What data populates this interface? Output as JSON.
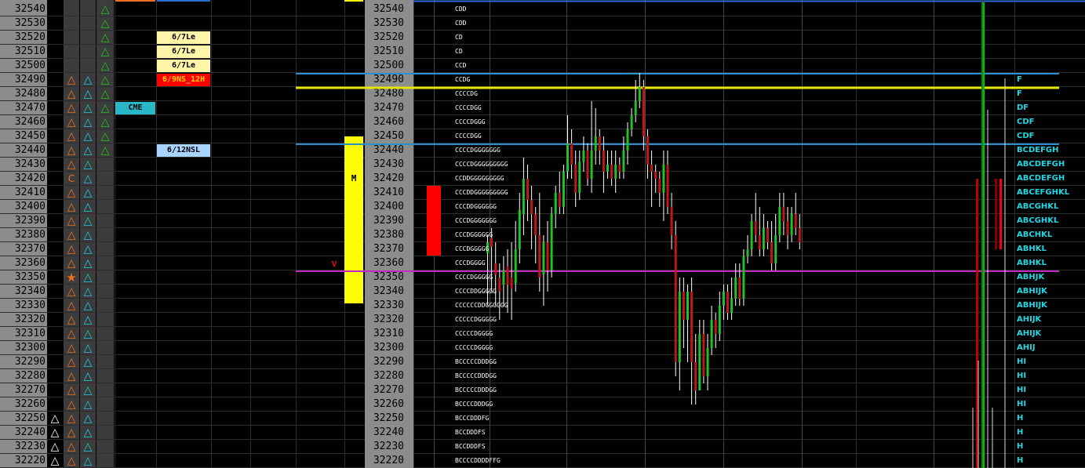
{
  "prices": [
    32540,
    32530,
    32520,
    32510,
    32500,
    32490,
    32480,
    32470,
    32460,
    32450,
    32440,
    32430,
    32420,
    32410,
    32400,
    32390,
    32380,
    32370,
    32360,
    32350,
    32340,
    32330,
    32320,
    32310,
    32300,
    32290,
    32280,
    32270,
    32260,
    32250,
    32240,
    32230,
    32220
  ],
  "markers": {
    "white_triangles": [
      32250,
      32240,
      32230,
      32220
    ],
    "orange_triangles": [
      32490,
      32480,
      32470,
      32460,
      32450,
      32440,
      32430,
      32410,
      32400,
      32390,
      32380,
      32370,
      32360,
      32340,
      32330,
      32320,
      32310,
      32300,
      32290,
      32280,
      32270,
      32260,
      32250,
      32240,
      32230,
      32220
    ],
    "orange_letter": {
      "price": 32420,
      "glyph": "C"
    },
    "orange_star": {
      "price": 32350,
      "glyph": "★"
    },
    "cyan_triangles": [
      32490,
      32480,
      32470,
      32460,
      32450,
      32440,
      32430,
      32420,
      32410,
      32400,
      32390,
      32380,
      32370,
      32360,
      32350,
      32340,
      32330,
      32320,
      32310,
      32300,
      32290,
      32280,
      32270,
      32260,
      32250,
      32240,
      32230,
      32220
    ],
    "green_triangles": [
      32540,
      32530,
      32520,
      32510,
      32500,
      32490,
      32480,
      32470,
      32460,
      32450,
      32440
    ],
    "triangle_glyph": "△"
  },
  "labels": {
    "cme": {
      "text": "CME",
      "price": 32470
    },
    "tags": [
      {
        "text": "6/7Le",
        "price": 32520,
        "style": "yellow"
      },
      {
        "text": "6/7Le",
        "price": 32510,
        "style": "yellow"
      },
      {
        "text": "6/7Le",
        "price": 32500,
        "style": "yellow"
      },
      {
        "text": "6/9NS_12H",
        "price": 32490,
        "style": "red"
      },
      {
        "text": "6/12NSL",
        "price": 32440,
        "style": "blue"
      }
    ],
    "v_marker": {
      "text": "v",
      "price": 32360
    },
    "m_marker": {
      "text": "M",
      "price": 32420
    }
  },
  "tpo_profile": [
    {
      "price": 32540,
      "text": "CDD"
    },
    {
      "price": 32530,
      "text": "CDD"
    },
    {
      "price": 32520,
      "text": "CD"
    },
    {
      "price": 32510,
      "text": "CD"
    },
    {
      "price": 32500,
      "text": "CCD"
    },
    {
      "price": 32490,
      "text": "CCDG"
    },
    {
      "price": 32480,
      "text": "CCCCDG"
    },
    {
      "price": 32470,
      "text": "CCCCDGG"
    },
    {
      "price": 32460,
      "text": "CCCCDGGG"
    },
    {
      "price": 32450,
      "text": "CCCCDGG"
    },
    {
      "price": 32440,
      "text": "CCCCDGGGGGGG"
    },
    {
      "price": 32430,
      "text": "CCCCDGGGGGGGGG"
    },
    {
      "price": 32420,
      "text": "CCDDGGGGGGGGG"
    },
    {
      "price": 32410,
      "text": "CCCDDGGGGGGGGG"
    },
    {
      "price": 32400,
      "text": "CCCDDGGGGGG"
    },
    {
      "price": 32390,
      "text": "CCCDGGGGGGG"
    },
    {
      "price": 32380,
      "text": "CCCDGGGGGG"
    },
    {
      "price": 32370,
      "text": "CCCDGGGGG"
    },
    {
      "price": 32360,
      "text": "CCCDGGGG"
    },
    {
      "price": 32350,
      "text": "CCCCDGGGGG"
    },
    {
      "price": 32340,
      "text": "CCCCDDGGGGG"
    },
    {
      "price": 32330,
      "text": "CCCCCCDDGGGGGG"
    },
    {
      "price": 32320,
      "text": "CCCCCDGGGGG"
    },
    {
      "price": 32310,
      "text": "CCCCCDGGGG"
    },
    {
      "price": 32300,
      "text": "CCCCCDGGGG"
    },
    {
      "price": 32290,
      "text": "BCCCCCDDDGG"
    },
    {
      "price": 32280,
      "text": "BCCCCCDDDGG"
    },
    {
      "price": 32270,
      "text": "BCCCCCDDDGG"
    },
    {
      "price": 32260,
      "text": "BCCCCDDDGG"
    },
    {
      "price": 32250,
      "text": "BCCCDDDFG"
    },
    {
      "price": 32240,
      "text": "BCCDDDFS"
    },
    {
      "price": 32230,
      "text": "BCCDDDFS"
    },
    {
      "price": 32220,
      "text": "BCCCCDDDDFFG"
    }
  ],
  "period_profile": [
    {
      "price": 32490,
      "text": "F"
    },
    {
      "price": 32480,
      "text": "F"
    },
    {
      "price": 32470,
      "text": "DF"
    },
    {
      "price": 32460,
      "text": "CDF"
    },
    {
      "price": 32450,
      "text": "CDF"
    },
    {
      "price": 32440,
      "text": "BCDEFGH"
    },
    {
      "price": 32430,
      "text": "ABCDEFGH"
    },
    {
      "price": 32420,
      "text": "ABCDEFGH"
    },
    {
      "price": 32410,
      "text": "ABCEFGHKL"
    },
    {
      "price": 32400,
      "text": "ABCGHKL"
    },
    {
      "price": 32390,
      "text": "ABCGHKL"
    },
    {
      "price": 32380,
      "text": "ABCHKL"
    },
    {
      "price": 32370,
      "text": "ABHKL"
    },
    {
      "price": 32360,
      "text": "ABHKL"
    },
    {
      "price": 32350,
      "text": "ABHJK"
    },
    {
      "price": 32340,
      "text": "ABHIJK"
    },
    {
      "price": 32330,
      "text": "ABHIJK"
    },
    {
      "price": 32320,
      "text": "AHIJK"
    },
    {
      "price": 32310,
      "text": "AHIJK"
    },
    {
      "price": 32300,
      "text": "AHIJ"
    },
    {
      "price": 32290,
      "text": "HI"
    },
    {
      "price": 32280,
      "text": "HI"
    },
    {
      "price": 32270,
      "text": "HI"
    },
    {
      "price": 32260,
      "text": "HI"
    },
    {
      "price": 32250,
      "text": "H"
    },
    {
      "price": 32240,
      "text": "H"
    },
    {
      "price": 32230,
      "text": "H"
    },
    {
      "price": 32220,
      "text": "H"
    }
  ],
  "level_lines": [
    {
      "price": 32490,
      "color": "#2a8fd0"
    },
    {
      "price": 32480,
      "color": "#e6e600"
    },
    {
      "price": 32440,
      "color": "#2a8fd0"
    },
    {
      "price": 32350,
      "color": "#c02ac0"
    }
  ],
  "candles": [
    {
      "o": 32367,
      "c": 32375,
      "h": 32380,
      "l": 32330
    },
    {
      "o": 32378,
      "c": 32372,
      "h": 32385,
      "l": 32340
    },
    {
      "o": 32360,
      "c": 32352,
      "h": 32375,
      "l": 32330
    },
    {
      "o": 32350,
      "c": 32340,
      "h": 32360,
      "l": 32320
    },
    {
      "o": 32345,
      "c": 32355,
      "h": 32365,
      "l": 32330
    },
    {
      "o": 32358,
      "c": 32345,
      "h": 32370,
      "l": 32325
    },
    {
      "o": 32350,
      "c": 32342,
      "h": 32375,
      "l": 32320
    },
    {
      "o": 32346,
      "c": 32370,
      "h": 32390,
      "l": 32340
    },
    {
      "o": 32370,
      "c": 32398,
      "h": 32410,
      "l": 32360
    },
    {
      "o": 32395,
      "c": 32420,
      "h": 32435,
      "l": 32380
    },
    {
      "o": 32420,
      "c": 32405,
      "h": 32430,
      "l": 32390
    },
    {
      "o": 32405,
      "c": 32395,
      "h": 32415,
      "l": 32370
    },
    {
      "o": 32395,
      "c": 32380,
      "h": 32400,
      "l": 32360
    },
    {
      "o": 32380,
      "c": 32350,
      "h": 32410,
      "l": 32340
    },
    {
      "o": 32352,
      "c": 32375,
      "h": 32380,
      "l": 32330
    },
    {
      "o": 32375,
      "c": 32355,
      "h": 32390,
      "l": 32340
    },
    {
      "o": 32355,
      "c": 32395,
      "h": 32400,
      "l": 32350
    },
    {
      "o": 32395,
      "c": 32410,
      "h": 32415,
      "l": 32385
    },
    {
      "o": 32410,
      "c": 32400,
      "h": 32425,
      "l": 32395
    },
    {
      "o": 32400,
      "c": 32425,
      "h": 32430,
      "l": 32395
    },
    {
      "o": 32425,
      "c": 32445,
      "h": 32465,
      "l": 32420
    },
    {
      "o": 32445,
      "c": 32430,
      "h": 32455,
      "l": 32420
    },
    {
      "o": 32430,
      "c": 32410,
      "h": 32440,
      "l": 32400
    },
    {
      "o": 32410,
      "c": 32432,
      "h": 32440,
      "l": 32405
    },
    {
      "o": 32432,
      "c": 32440,
      "h": 32450,
      "l": 32425
    },
    {
      "o": 32440,
      "c": 32420,
      "h": 32445,
      "l": 32415
    },
    {
      "o": 32420,
      "c": 32440,
      "h": 32475,
      "l": 32410
    },
    {
      "o": 32440,
      "c": 32450,
      "h": 32470,
      "l": 32430
    },
    {
      "o": 32450,
      "c": 32440,
      "h": 32455,
      "l": 32430
    },
    {
      "o": 32440,
      "c": 32425,
      "h": 32450,
      "l": 32410
    },
    {
      "o": 32425,
      "c": 32430,
      "h": 32440,
      "l": 32420
    },
    {
      "o": 32430,
      "c": 32420,
      "h": 32440,
      "l": 32415
    },
    {
      "o": 32420,
      "c": 32430,
      "h": 32440,
      "l": 32410
    },
    {
      "o": 32430,
      "c": 32425,
      "h": 32435,
      "l": 32420
    },
    {
      "o": 32425,
      "c": 32440,
      "h": 32450,
      "l": 32420
    },
    {
      "o": 32440,
      "c": 32455,
      "h": 32460,
      "l": 32430
    },
    {
      "o": 32455,
      "c": 32465,
      "h": 32470,
      "l": 32450
    },
    {
      "o": 32465,
      "c": 32475,
      "h": 32490,
      "l": 32460
    },
    {
      "o": 32475,
      "c": 32485,
      "h": 32495,
      "l": 32470
    },
    {
      "o": 32485,
      "c": 32450,
      "h": 32490,
      "l": 32440
    },
    {
      "o": 32450,
      "c": 32430,
      "h": 32455,
      "l": 32420
    },
    {
      "o": 32430,
      "c": 32425,
      "h": 32440,
      "l": 32400
    },
    {
      "o": 32425,
      "c": 32420,
      "h": 32430,
      "l": 32410
    },
    {
      "o": 32420,
      "c": 32410,
      "h": 32425,
      "l": 32400
    },
    {
      "o": 32410,
      "c": 32430,
      "h": 32440,
      "l": 32390
    },
    {
      "o": 32430,
      "c": 32400,
      "h": 32440,
      "l": 32395
    },
    {
      "o": 32400,
      "c": 32380,
      "h": 32410,
      "l": 32370
    },
    {
      "o": 32380,
      "c": 32290,
      "h": 32390,
      "l": 32280
    },
    {
      "o": 32290,
      "c": 32340,
      "h": 32350,
      "l": 32270
    },
    {
      "o": 32340,
      "c": 32320,
      "h": 32350,
      "l": 32300
    },
    {
      "o": 32320,
      "c": 32340,
      "h": 32345,
      "l": 32290
    },
    {
      "o": 32340,
      "c": 32290,
      "h": 32350,
      "l": 32260
    },
    {
      "o": 32290,
      "c": 32270,
      "h": 32310,
      "l": 32260
    },
    {
      "o": 32270,
      "c": 32310,
      "h": 32320,
      "l": 32270
    },
    {
      "o": 32310,
      "c": 32280,
      "h": 32320,
      "l": 32275
    },
    {
      "o": 32280,
      "c": 32300,
      "h": 32310,
      "l": 32270
    },
    {
      "o": 32300,
      "c": 32320,
      "h": 32330,
      "l": 32295
    },
    {
      "o": 32320,
      "c": 32310,
      "h": 32325,
      "l": 32300
    },
    {
      "o": 32310,
      "c": 32330,
      "h": 32340,
      "l": 32305
    },
    {
      "o": 32330,
      "c": 32340,
      "h": 32345,
      "l": 32320
    },
    {
      "o": 32340,
      "c": 32325,
      "h": 32345,
      "l": 32320
    },
    {
      "o": 32325,
      "c": 32335,
      "h": 32350,
      "l": 32320
    },
    {
      "o": 32335,
      "c": 32350,
      "h": 32360,
      "l": 32330
    },
    {
      "o": 32350,
      "c": 32335,
      "h": 32360,
      "l": 32330
    },
    {
      "o": 32335,
      "c": 32365,
      "h": 32370,
      "l": 32330
    },
    {
      "o": 32365,
      "c": 32370,
      "h": 32380,
      "l": 32360
    },
    {
      "o": 32370,
      "c": 32390,
      "h": 32395,
      "l": 32365
    },
    {
      "o": 32390,
      "c": 32380,
      "h": 32410,
      "l": 32375
    },
    {
      "o": 32380,
      "c": 32370,
      "h": 32400,
      "l": 32365
    },
    {
      "o": 32370,
      "c": 32385,
      "h": 32395,
      "l": 32365
    },
    {
      "o": 32385,
      "c": 32375,
      "h": 32390,
      "l": 32370
    },
    {
      "o": 32375,
      "c": 32360,
      "h": 32390,
      "l": 32355
    },
    {
      "o": 32360,
      "c": 32380,
      "h": 32395,
      "l": 32355
    },
    {
      "o": 32380,
      "c": 32400,
      "h": 32410,
      "l": 32375
    },
    {
      "o": 32400,
      "c": 32390,
      "h": 32410,
      "l": 32380
    },
    {
      "o": 32390,
      "c": 32380,
      "h": 32400,
      "l": 32370
    },
    {
      "o": 32380,
      "c": 32395,
      "h": 32400,
      "l": 32375
    },
    {
      "o": 32395,
      "c": 32385,
      "h": 32410,
      "l": 32380
    },
    {
      "o": 32385,
      "c": 32375,
      "h": 32395,
      "l": 32370
    }
  ],
  "big_candle": {
    "o": 32420,
    "c": 32370,
    "h": 32420,
    "l": 32370,
    "color": "#ff0000"
  },
  "right_bars": [
    {
      "color": "#0a8a0a",
      "h": 32545,
      "l": 32210
    },
    {
      "color": "#00c000",
      "h": 32545,
      "l": 32210
    },
    {
      "color": "#c00000",
      "h": 32420,
      "l": 32210
    },
    {
      "color": "#8a0000",
      "h": 32420,
      "l": 32370
    },
    {
      "color": "#ff0000",
      "h": 32420,
      "l": 32370
    }
  ],
  "colors": {
    "price_panel": "#8c8c8c",
    "grid": "#3a3a3a",
    "green": "#22c022",
    "orange": "#f07020",
    "cyan": "#22c8e6",
    "yellow_bar": "#ffff00",
    "tag_yellow": "#fff5a8",
    "tag_red": "#ff0000",
    "tag_blue": "#a8d4ff",
    "cme_bg": "#2ab8c8",
    "candle_up": "#22c022",
    "candle_down": "#c01818"
  }
}
